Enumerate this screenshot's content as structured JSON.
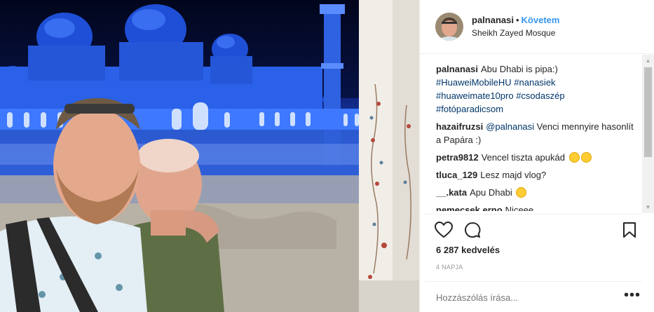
{
  "post": {
    "username": "palnanasi",
    "dot": "•",
    "follow_label": "Követem",
    "location": "Sheikh Zayed Mosque",
    "photo_alt": "Selfie in front of Sheikh Zayed Mosque at night"
  },
  "caption": {
    "username": "palnanasi",
    "text": "Abu Dhabi is pipa:)",
    "tags": [
      "#HuaweiMobileHU",
      "#nanasiek",
      "#huaweimate10pro",
      "#csodaszép",
      "#fotóparadicsom"
    ]
  },
  "comments": [
    {
      "user": "hazaifruzsi",
      "mention": "@palnanasi",
      "text": "Venci mennyire hasonlít a Papára :)"
    },
    {
      "user": "petra9812",
      "text": "Vencel tiszta apukád"
    },
    {
      "user": "tluca_129",
      "text": "Lesz majd vlog?"
    },
    {
      "user": "__.kata",
      "text": "Apu Dhabi"
    },
    {
      "user": "nemecsek.erno",
      "text": "Niceee"
    }
  ],
  "likes": "6 287 kedvelés",
  "age": "4 NAPJA",
  "add_comment_placeholder": "Hozzászólás írása...",
  "icons": {
    "like": "heart-icon",
    "comment": "comment-icon",
    "save": "bookmark-icon",
    "more": "more-options-icon"
  },
  "colors": {
    "link": "#3897f0",
    "hashtag": "#003569",
    "text": "#262626",
    "muted": "#999999"
  }
}
